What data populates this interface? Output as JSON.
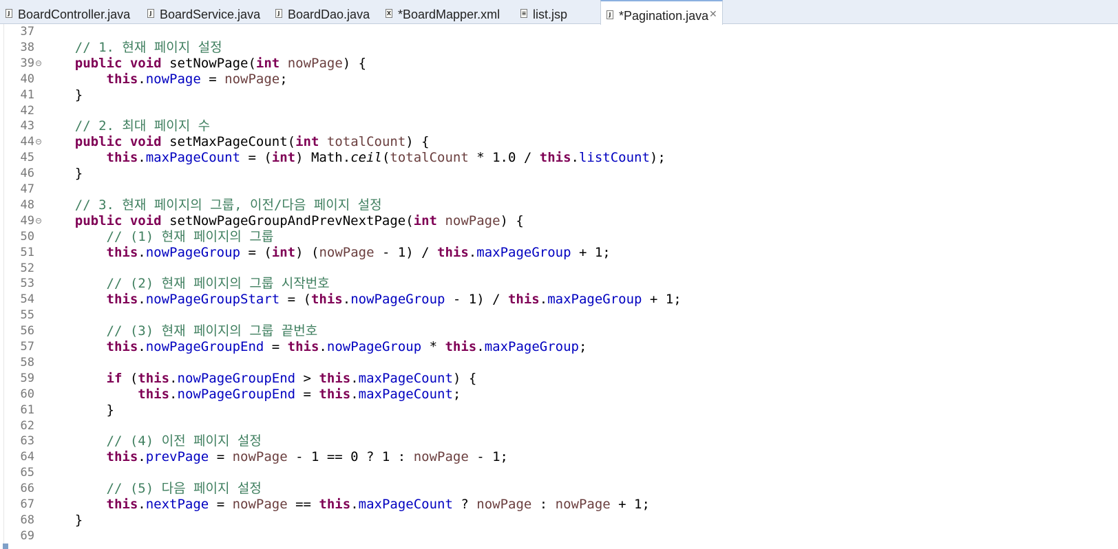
{
  "tabs": [
    {
      "label": "BoardController.java",
      "icon": "java-file-icon",
      "active": false
    },
    {
      "label": "BoardService.java",
      "icon": "java-file-icon",
      "active": false
    },
    {
      "label": "BoardDao.java",
      "icon": "java-file-icon",
      "active": false
    },
    {
      "label": "*BoardMapper.xml",
      "icon": "xml-file-icon",
      "active": false
    },
    {
      "label": "list.jsp",
      "icon": "jsp-file-icon",
      "active": false
    },
    {
      "label": "*Pagination.java",
      "icon": "java-file-icon",
      "active": true
    }
  ],
  "tab_close_glyph": "✕",
  "colors": {
    "keyword": "#7f0055",
    "field": "#0000c0",
    "local_variable": "#6a3e3e",
    "comment": "#3f7f5f",
    "line_number": "#787878"
  },
  "editor": {
    "lines": [
      {
        "n": "37",
        "fold": false,
        "tokens": []
      },
      {
        "n": "38",
        "fold": false,
        "tokens": [
          [
            "cm",
            "    // 1. 현재 페이지 설정"
          ]
        ]
      },
      {
        "n": "39",
        "fold": true,
        "tokens": [
          [
            "",
            "    "
          ],
          [
            "kw",
            "public"
          ],
          [
            "",
            " "
          ],
          [
            "kw",
            "void"
          ],
          [
            "",
            " setNowPage("
          ],
          [
            "kw",
            "int"
          ],
          [
            "",
            " "
          ],
          [
            "var",
            "nowPage"
          ],
          [
            "",
            ") {"
          ]
        ]
      },
      {
        "n": "40",
        "fold": false,
        "tokens": [
          [
            "",
            "        "
          ],
          [
            "kw",
            "this"
          ],
          [
            "",
            "."
          ],
          [
            "fld",
            "nowPage"
          ],
          [
            "",
            " = "
          ],
          [
            "var",
            "nowPage"
          ],
          [
            "",
            ";"
          ]
        ]
      },
      {
        "n": "41",
        "fold": false,
        "tokens": [
          [
            "",
            "    }"
          ]
        ]
      },
      {
        "n": "42",
        "fold": false,
        "tokens": []
      },
      {
        "n": "43",
        "fold": false,
        "tokens": [
          [
            "cm",
            "    // 2. 최대 페이지 수"
          ]
        ]
      },
      {
        "n": "44",
        "fold": true,
        "tokens": [
          [
            "",
            "    "
          ],
          [
            "kw",
            "public"
          ],
          [
            "",
            " "
          ],
          [
            "kw",
            "void"
          ],
          [
            "",
            " setMaxPageCount("
          ],
          [
            "kw",
            "int"
          ],
          [
            "",
            " "
          ],
          [
            "var",
            "totalCount"
          ],
          [
            "",
            ") {"
          ]
        ]
      },
      {
        "n": "45",
        "fold": false,
        "tokens": [
          [
            "",
            "        "
          ],
          [
            "kw",
            "this"
          ],
          [
            "",
            "."
          ],
          [
            "fld",
            "maxPageCount"
          ],
          [
            "",
            " = ("
          ],
          [
            "kw",
            "int"
          ],
          [
            "",
            ") Math."
          ],
          [
            "it",
            "ceil"
          ],
          [
            "",
            "("
          ],
          [
            "var",
            "totalCount"
          ],
          [
            "",
            " * 1.0 / "
          ],
          [
            "kw",
            "this"
          ],
          [
            "",
            "."
          ],
          [
            "fld",
            "listCount"
          ],
          [
            "",
            ");"
          ]
        ]
      },
      {
        "n": "46",
        "fold": false,
        "tokens": [
          [
            "",
            "    }"
          ]
        ]
      },
      {
        "n": "47",
        "fold": false,
        "tokens": []
      },
      {
        "n": "48",
        "fold": false,
        "tokens": [
          [
            "cm",
            "    // 3. 현재 페이지의 그룹, 이전/다음 페이지 설정"
          ]
        ]
      },
      {
        "n": "49",
        "fold": true,
        "tokens": [
          [
            "",
            "    "
          ],
          [
            "kw",
            "public"
          ],
          [
            "",
            " "
          ],
          [
            "kw",
            "void"
          ],
          [
            "",
            " setNowPageGroupAndPrevNextPage("
          ],
          [
            "kw",
            "int"
          ],
          [
            "",
            " "
          ],
          [
            "var",
            "nowPage"
          ],
          [
            "",
            ") {"
          ]
        ]
      },
      {
        "n": "50",
        "fold": false,
        "tokens": [
          [
            "cm",
            "        // (1) 현재 페이지의 그룹"
          ]
        ]
      },
      {
        "n": "51",
        "fold": false,
        "tokens": [
          [
            "",
            "        "
          ],
          [
            "kw",
            "this"
          ],
          [
            "",
            "."
          ],
          [
            "fld",
            "nowPageGroup"
          ],
          [
            "",
            " = ("
          ],
          [
            "kw",
            "int"
          ],
          [
            "",
            ") ("
          ],
          [
            "var",
            "nowPage"
          ],
          [
            "",
            " - 1) / "
          ],
          [
            "kw",
            "this"
          ],
          [
            "",
            "."
          ],
          [
            "fld",
            "maxPageGroup"
          ],
          [
            "",
            " + 1;"
          ]
        ]
      },
      {
        "n": "52",
        "fold": false,
        "tokens": []
      },
      {
        "n": "53",
        "fold": false,
        "tokens": [
          [
            "cm",
            "        // (2) 현재 페이지의 그룹 시작번호"
          ]
        ]
      },
      {
        "n": "54",
        "fold": false,
        "tokens": [
          [
            "",
            "        "
          ],
          [
            "kw",
            "this"
          ],
          [
            "",
            "."
          ],
          [
            "fld",
            "nowPageGroupStart"
          ],
          [
            "",
            " = ("
          ],
          [
            "kw",
            "this"
          ],
          [
            "",
            "."
          ],
          [
            "fld",
            "nowPageGroup"
          ],
          [
            "",
            " - 1) / "
          ],
          [
            "kw",
            "this"
          ],
          [
            "",
            "."
          ],
          [
            "fld",
            "maxPageGroup"
          ],
          [
            "",
            " + 1;"
          ]
        ]
      },
      {
        "n": "55",
        "fold": false,
        "tokens": []
      },
      {
        "n": "56",
        "fold": false,
        "tokens": [
          [
            "cm",
            "        // (3) 현재 페이지의 그룹 끝번호"
          ]
        ]
      },
      {
        "n": "57",
        "fold": false,
        "tokens": [
          [
            "",
            "        "
          ],
          [
            "kw",
            "this"
          ],
          [
            "",
            "."
          ],
          [
            "fld",
            "nowPageGroupEnd"
          ],
          [
            "",
            " = "
          ],
          [
            "kw",
            "this"
          ],
          [
            "",
            "."
          ],
          [
            "fld",
            "nowPageGroup"
          ],
          [
            "",
            " * "
          ],
          [
            "kw",
            "this"
          ],
          [
            "",
            "."
          ],
          [
            "fld",
            "maxPageGroup"
          ],
          [
            "",
            ";"
          ]
        ]
      },
      {
        "n": "58",
        "fold": false,
        "tokens": []
      },
      {
        "n": "59",
        "fold": false,
        "tokens": [
          [
            "",
            "        "
          ],
          [
            "kw",
            "if"
          ],
          [
            "",
            " ("
          ],
          [
            "kw",
            "this"
          ],
          [
            "",
            "."
          ],
          [
            "fld",
            "nowPageGroupEnd"
          ],
          [
            "",
            " > "
          ],
          [
            "kw",
            "this"
          ],
          [
            "",
            "."
          ],
          [
            "fld",
            "maxPageCount"
          ],
          [
            "",
            ") {"
          ]
        ]
      },
      {
        "n": "60",
        "fold": false,
        "tokens": [
          [
            "",
            "            "
          ],
          [
            "kw",
            "this"
          ],
          [
            "",
            "."
          ],
          [
            "fld",
            "nowPageGroupEnd"
          ],
          [
            "",
            " = "
          ],
          [
            "kw",
            "this"
          ],
          [
            "",
            "."
          ],
          [
            "fld",
            "maxPageCount"
          ],
          [
            "",
            ";"
          ]
        ]
      },
      {
        "n": "61",
        "fold": false,
        "tokens": [
          [
            "",
            "        }"
          ]
        ]
      },
      {
        "n": "62",
        "fold": false,
        "tokens": []
      },
      {
        "n": "63",
        "fold": false,
        "tokens": [
          [
            "cm",
            "        // (4) 이전 페이지 설정"
          ]
        ]
      },
      {
        "n": "64",
        "fold": false,
        "tokens": [
          [
            "",
            "        "
          ],
          [
            "kw",
            "this"
          ],
          [
            "",
            "."
          ],
          [
            "fld",
            "prevPage"
          ],
          [
            "",
            " = "
          ],
          [
            "var",
            "nowPage"
          ],
          [
            "",
            " - 1 == 0 ? 1 : "
          ],
          [
            "var",
            "nowPage"
          ],
          [
            "",
            " - 1;"
          ]
        ]
      },
      {
        "n": "65",
        "fold": false,
        "tokens": []
      },
      {
        "n": "66",
        "fold": false,
        "tokens": [
          [
            "cm",
            "        // (5) 다음 페이지 설정"
          ]
        ]
      },
      {
        "n": "67",
        "fold": false,
        "tokens": [
          [
            "",
            "        "
          ],
          [
            "kw",
            "this"
          ],
          [
            "",
            "."
          ],
          [
            "fld",
            "nextPage"
          ],
          [
            "",
            " = "
          ],
          [
            "var",
            "nowPage"
          ],
          [
            "",
            " == "
          ],
          [
            "kw",
            "this"
          ],
          [
            "",
            "."
          ],
          [
            "fld",
            "maxPageCount"
          ],
          [
            "",
            " ? "
          ],
          [
            "var",
            "nowPage"
          ],
          [
            "",
            " : "
          ],
          [
            "var",
            "nowPage"
          ],
          [
            "",
            " + 1;"
          ]
        ]
      },
      {
        "n": "68",
        "fold": false,
        "tokens": [
          [
            "",
            "    }"
          ]
        ]
      },
      {
        "n": "69",
        "fold": false,
        "tokens": []
      }
    ]
  }
}
